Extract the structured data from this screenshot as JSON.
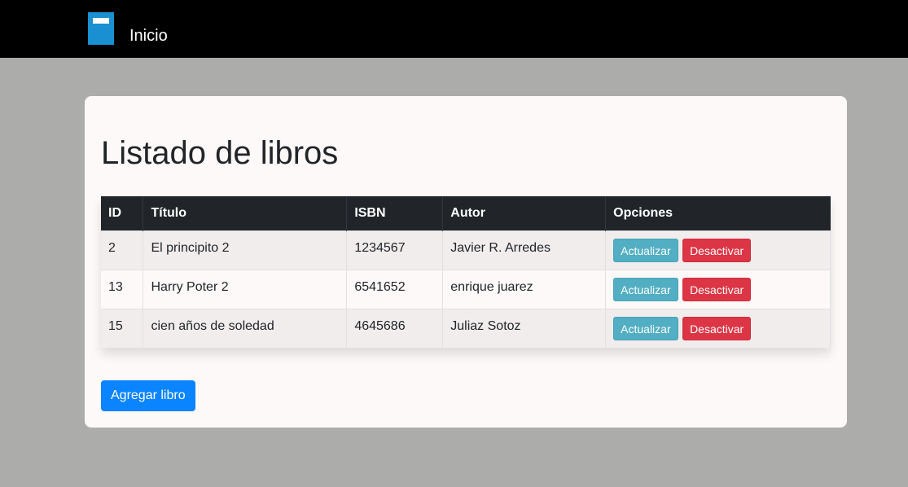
{
  "navbar": {
    "link_label": "Inicio",
    "brand_icon": "book-icon"
  },
  "page": {
    "title": "Listado de libros"
  },
  "table": {
    "headers": [
      "ID",
      "Título",
      "ISBN",
      "Autor",
      "Opciones"
    ],
    "rows": [
      {
        "id": "2",
        "titulo": "El principito 2",
        "isbn": "1234567",
        "autor": "Javier R. Arredes"
      },
      {
        "id": "13",
        "titulo": "Harry Poter 2",
        "isbn": "6541652",
        "autor": "enrique juarez"
      },
      {
        "id": "15",
        "titulo": "cien años de soledad",
        "isbn": "4645686",
        "autor": "Juliaz Sotoz"
      }
    ],
    "actions": {
      "update_label": "Actualizar",
      "deactivate_label": "Desactivar"
    }
  },
  "add_button_label": "Agregar libro",
  "colors": {
    "navbar_bg": "#000000",
    "page_bg": "#acacaa",
    "table_header_bg": "#212529",
    "info_button": "#52aec3",
    "danger_button": "#dc3545",
    "primary_button": "#0a84ff"
  }
}
